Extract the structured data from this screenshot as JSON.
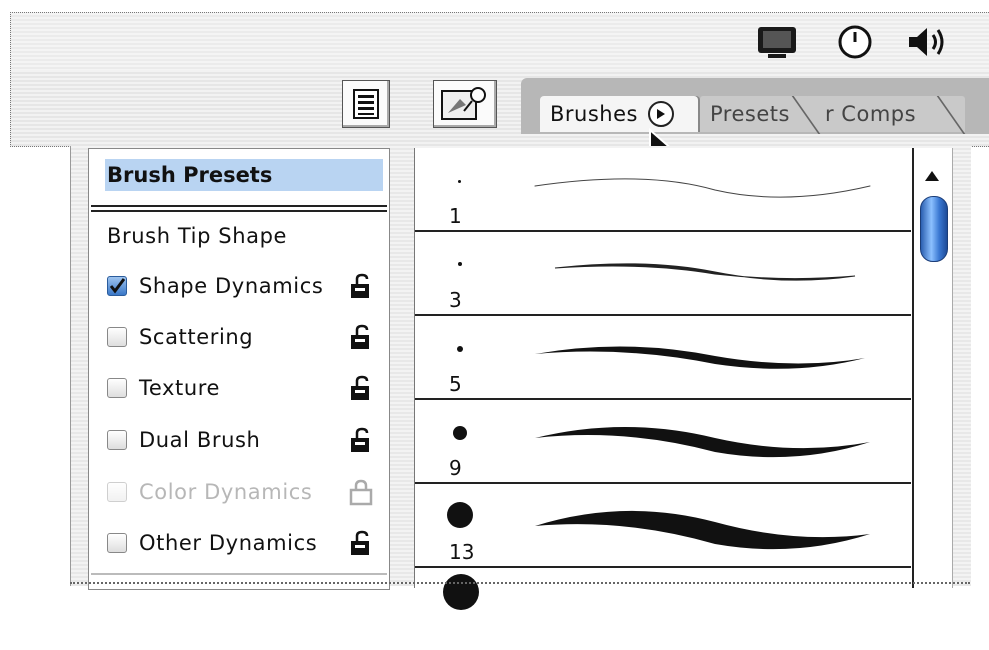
{
  "system_icons": [
    "display-icon",
    "clock-icon",
    "volume-icon"
  ],
  "toolbar": {
    "palette_button_icon": "palette-well-icon",
    "tool_button_icon": "brush-tool-icon"
  },
  "tabs": [
    {
      "label": "Brushes",
      "active": true
    },
    {
      "label": "Presets",
      "active": false
    },
    {
      "label": "r Comps",
      "active": false
    }
  ],
  "left_panel": {
    "selected": "Brush Presets",
    "header_item": "Brush Tip Shape",
    "options": [
      {
        "label": "Shape Dynamics",
        "checked": true,
        "enabled": true
      },
      {
        "label": "Scattering",
        "checked": false,
        "enabled": true
      },
      {
        "label": "Texture",
        "checked": false,
        "enabled": true
      },
      {
        "label": "Dual Brush",
        "checked": false,
        "enabled": true
      },
      {
        "label": "Color Dynamics",
        "checked": false,
        "enabled": false
      },
      {
        "label": "Other Dynamics",
        "checked": false,
        "enabled": true
      }
    ]
  },
  "brushes": [
    {
      "size": "1"
    },
    {
      "size": "3"
    },
    {
      "size": "5"
    },
    {
      "size": "9"
    },
    {
      "size": "13"
    }
  ],
  "colors": {
    "selection": "#b9d4f2",
    "scroll_thumb": "#3a78d2",
    "tab_well": "#b7b7b7"
  }
}
